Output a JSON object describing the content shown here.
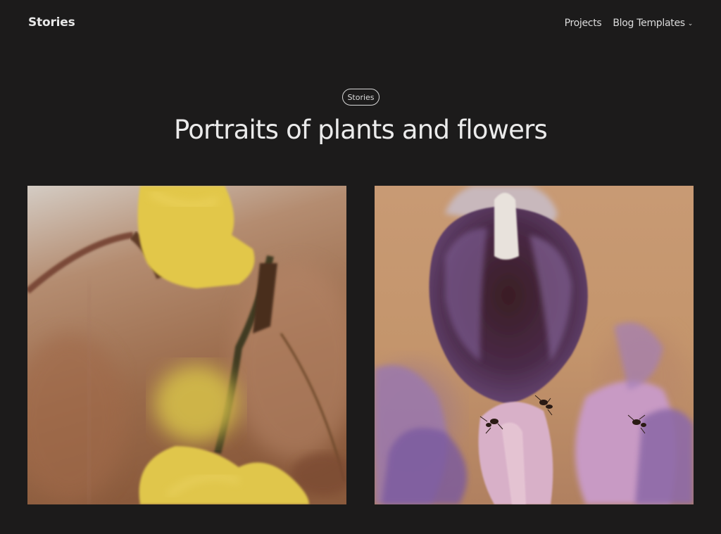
{
  "header": {
    "site_title": "Stories",
    "nav": [
      {
        "label": "Projects"
      },
      {
        "label": "Blog Templates",
        "icon": "chevron-down-icon"
      }
    ]
  },
  "hero": {
    "category": "Stories",
    "title": "Portraits of plants and flowers"
  },
  "gallery": [
    {
      "subject": "yellow flower photo"
    },
    {
      "subject": "purple lupine flower photo"
    }
  ],
  "colors": {
    "background": "#1c1b1b",
    "text": "#ededed"
  }
}
